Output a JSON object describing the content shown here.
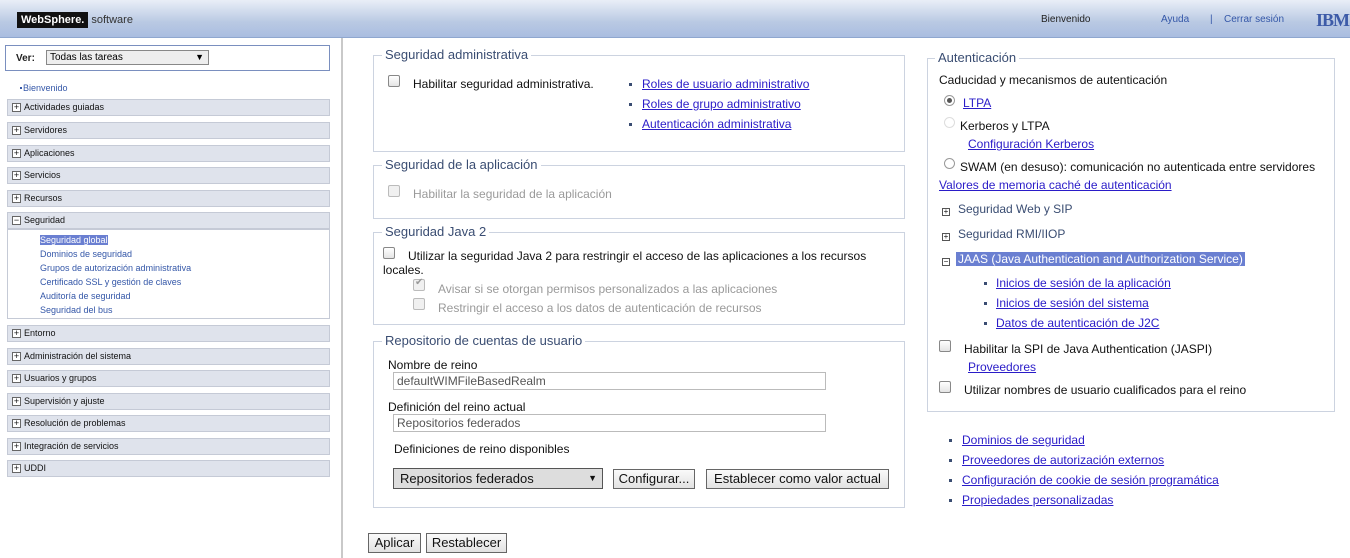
{
  "header": {
    "brand": "WebSphere.",
    "brand_suffix": "software",
    "welcome": "Bienvenido",
    "help": "Ayuda",
    "logout": "Cerrar sesión",
    "ibm": "IBM"
  },
  "nav": {
    "view_label": "Ver:",
    "view_value": "Todas las tareas",
    "welcome_link": "Bienvenido",
    "items": [
      "Actividades guiadas",
      "Servidores",
      "Aplicaciones",
      "Servicios",
      "Recursos",
      "Seguridad",
      "Entorno",
      "Administración del sistema",
      "Usuarios y grupos",
      "Supervisión y ajuste",
      "Resolución de problemas",
      "Integración de servicios",
      "UDDI"
    ],
    "security_sub": [
      "Seguridad global",
      "Dominios de seguridad",
      "Grupos de autorización administrativa",
      "Certificado SSL y gestión de claves",
      "Auditoría de seguridad",
      "Seguridad del bus"
    ]
  },
  "admin_sec": {
    "legend": "Seguridad administrativa",
    "enable": "Habilitar seguridad administrativa.",
    "links": [
      "Roles de usuario administrativo",
      "Roles de grupo administrativo",
      "Autenticación administrativa"
    ]
  },
  "app_sec": {
    "legend": "Seguridad de la aplicación",
    "enable": "Habilitar la seguridad de la aplicación"
  },
  "java2": {
    "legend": "Seguridad Java 2",
    "use": "Utilizar la seguridad Java 2 para restringir el acceso de las aplicaciones a los recursos",
    "use2": "locales.",
    "warn": "Avisar si se otorgan permisos personalizados a las aplicaciones",
    "restrict": "Restringir el acceso a los datos de autenticación de recursos"
  },
  "repo": {
    "legend": "Repositorio de cuentas de usuario",
    "realm_label": "Nombre de reino",
    "realm_value": "defaultWIMFileBasedRealm",
    "current_label": "Definición del reino actual",
    "current_value": "Repositorios federados",
    "avail_label": "Definiciones de reino disponibles",
    "select_value": "Repositorios federados",
    "configure": "Configurar...",
    "set_current": "Establecer como valor actual"
  },
  "buttons": {
    "apply": "Aplicar",
    "reset": "Restablecer"
  },
  "auth": {
    "legend": "Autenticación",
    "mech_title": "Caducidad y mecanismos de autenticación",
    "ltpa": "LTPA",
    "kerberos": "Kerberos y LTPA",
    "kerberos_config": "Configuración Kerberos",
    "swam": "SWAM (en desuso): comunicación no autenticada entre servidores",
    "cache": "Valores de memoria caché de autenticación",
    "web_sip": "Seguridad Web y SIP",
    "rmi": "Seguridad RMI/IIOP",
    "jaas": "JAAS (Java Authentication and Authorization Service)",
    "jaas_links": [
      "Inicios de sesión de la aplicación",
      "Inicios de sesión del sistema",
      "Datos de autenticación de J2C"
    ],
    "jaspi": "Habilitar la SPI de Java Authentication (JASPI)",
    "providers": "Proveedores",
    "qualified": "Utilizar nombres de usuario cualificados para el reino"
  },
  "related": [
    "Dominios de seguridad",
    "Proveedores de autorización externos",
    "Configuración de cookie de sesión programática",
    "Propiedades personalizadas"
  ]
}
